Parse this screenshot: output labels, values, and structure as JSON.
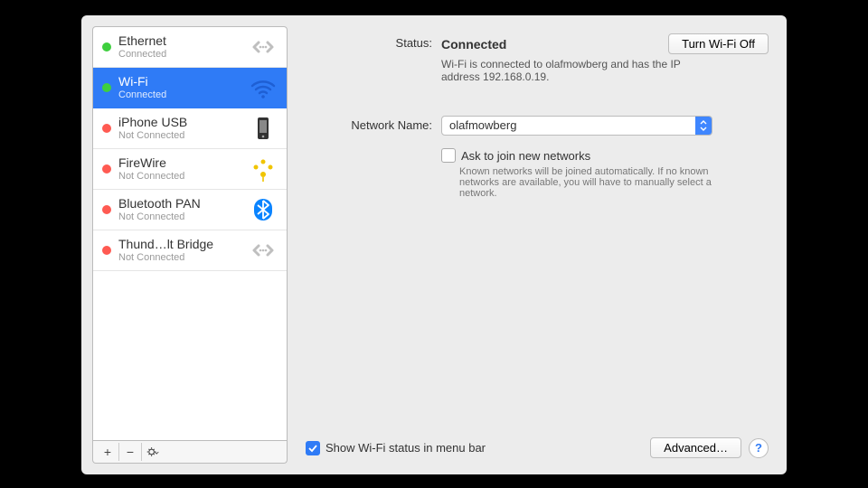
{
  "sidebar": {
    "items": [
      {
        "title": "Ethernet",
        "sub": "Connected",
        "statusColor": "green",
        "iconType": "arrows"
      },
      {
        "title": "Wi-Fi",
        "sub": "Connected",
        "statusColor": "green",
        "iconType": "wifi"
      },
      {
        "title": "iPhone USB",
        "sub": "Not Connected",
        "statusColor": "red",
        "iconType": "phone"
      },
      {
        "title": "FireWire",
        "sub": "Not Connected",
        "statusColor": "red",
        "iconType": "firewire"
      },
      {
        "title": "Bluetooth PAN",
        "sub": "Not Connected",
        "statusColor": "red",
        "iconType": "bluetooth"
      },
      {
        "title": "Thund…lt Bridge",
        "sub": "Not Connected",
        "statusColor": "red",
        "iconType": "arrows"
      }
    ],
    "selectedIndex": 1,
    "footer": {
      "add": "+",
      "remove": "−"
    }
  },
  "detail": {
    "status_label": "Status:",
    "status_value": "Connected",
    "turn_off_label": "Turn Wi-Fi Off",
    "status_desc": "Wi-Fi is connected to olafmowberg and has the IP address 192.168.0.19.",
    "network_name_label": "Network Name:",
    "network_name_value": "olafmowberg",
    "ask_join_label": "Ask to join new networks",
    "ask_join_checked": false,
    "ask_join_help": "Known networks will be joined automatically. If no known networks are available, you will have to manually select a network.",
    "show_menubar_label": "Show Wi-Fi status in menu bar",
    "show_menubar_checked": true,
    "advanced_label": "Advanced…",
    "help_label": "?"
  }
}
